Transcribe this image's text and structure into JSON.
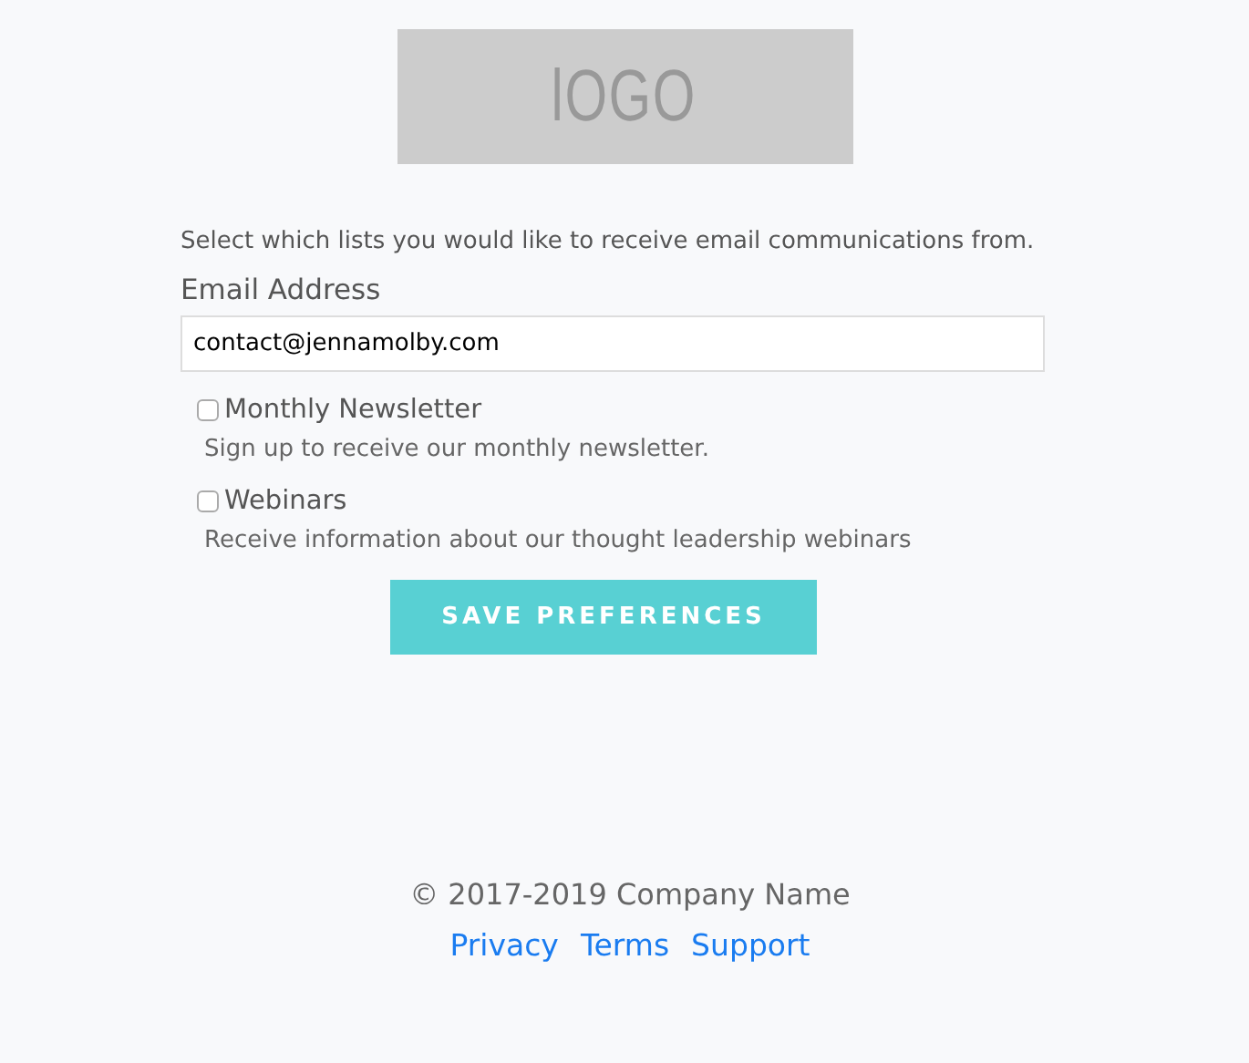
{
  "logo": {
    "text": "lOGO"
  },
  "intro": "Select which lists you would like to receive email communications from.",
  "email": {
    "label": "Email Address",
    "value": "contact@jennamolby.com"
  },
  "lists": [
    {
      "label": "Monthly Newsletter",
      "description": "Sign up to receive our monthly newsletter.",
      "checked": false
    },
    {
      "label": "Webinars",
      "description": "Receive information about our thought leadership webinars",
      "checked": false
    }
  ],
  "button": "SAVE PREFERENCES",
  "footer": {
    "copyright": "© 2017-2019 Company Name",
    "links": [
      "Privacy",
      "Terms",
      "Support"
    ]
  }
}
